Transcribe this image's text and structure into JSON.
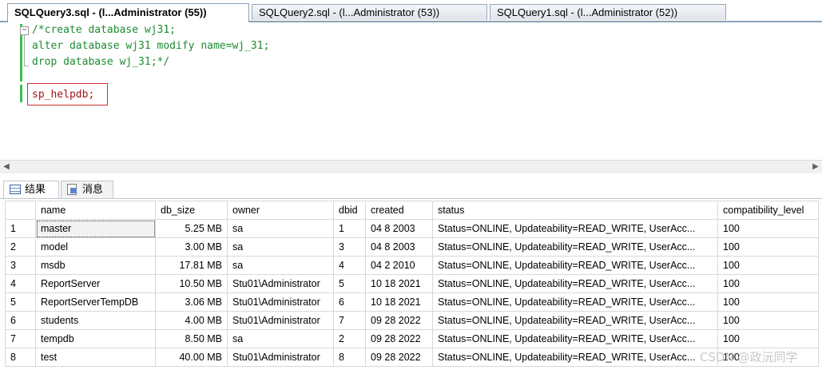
{
  "tabs": [
    {
      "label": "SQLQuery3.sql - (l...Administrator (55))",
      "active": true
    },
    {
      "label": "SQLQuery2.sql - (l...Administrator (53))",
      "active": false
    },
    {
      "label": "SQLQuery1.sql - (l...Administrator (52))",
      "active": false
    }
  ],
  "editor": {
    "lines": [
      "/*create database wj31;",
      "alter database wj31 modify name=wj_31;",
      "drop database wj_31;*/",
      "sp_helpdb;"
    ],
    "comment_color": "#1f8a33",
    "highlight_color": "#d03030"
  },
  "result_tabs": [
    {
      "label": "结果",
      "icon": "grid-icon",
      "active": true
    },
    {
      "label": "消息",
      "icon": "messages-icon",
      "active": false
    }
  ],
  "grid": {
    "columns": [
      "name",
      "db_size",
      "owner",
      "dbid",
      "created",
      "status",
      "compatibility_level"
    ],
    "rows": [
      {
        "n": "1",
        "name": "master",
        "db_size": "5.25 MB",
        "owner": "sa",
        "dbid": "1",
        "created": "04  8 2003",
        "status": "Status=ONLINE, Updateability=READ_WRITE, UserAcc...",
        "compat": "100"
      },
      {
        "n": "2",
        "name": "model",
        "db_size": "3.00 MB",
        "owner": "sa",
        "dbid": "3",
        "created": "04  8 2003",
        "status": "Status=ONLINE, Updateability=READ_WRITE, UserAcc...",
        "compat": "100"
      },
      {
        "n": "3",
        "name": "msdb",
        "db_size": "17.81 MB",
        "owner": "sa",
        "dbid": "4",
        "created": "04  2 2010",
        "status": "Status=ONLINE, Updateability=READ_WRITE, UserAcc...",
        "compat": "100"
      },
      {
        "n": "4",
        "name": "ReportServer",
        "db_size": "10.50 MB",
        "owner": "Stu01\\Administrator",
        "dbid": "5",
        "created": "10 18 2021",
        "status": "Status=ONLINE, Updateability=READ_WRITE, UserAcc...",
        "compat": "100"
      },
      {
        "n": "5",
        "name": "ReportServerTempDB",
        "db_size": "3.06 MB",
        "owner": "Stu01\\Administrator",
        "dbid": "6",
        "created": "10 18 2021",
        "status": "Status=ONLINE, Updateability=READ_WRITE, UserAcc...",
        "compat": "100"
      },
      {
        "n": "6",
        "name": "students",
        "db_size": "4.00 MB",
        "owner": "Stu01\\Administrator",
        "dbid": "7",
        "created": "09 28 2022",
        "status": "Status=ONLINE, Updateability=READ_WRITE, UserAcc...",
        "compat": "100"
      },
      {
        "n": "7",
        "name": "tempdb",
        "db_size": "8.50 MB",
        "owner": "sa",
        "dbid": "2",
        "created": "09 28 2022",
        "status": "Status=ONLINE, Updateability=READ_WRITE, UserAcc...",
        "compat": "100"
      },
      {
        "n": "8",
        "name": "test",
        "db_size": "40.00 MB",
        "owner": "Stu01\\Administrator",
        "dbid": "8",
        "created": "09 28 2022",
        "status": "Status=ONLINE, Updateability=READ_WRITE, UserAcc...",
        "compat": "100"
      }
    ]
  },
  "watermark": "CSDN @政沅同学"
}
